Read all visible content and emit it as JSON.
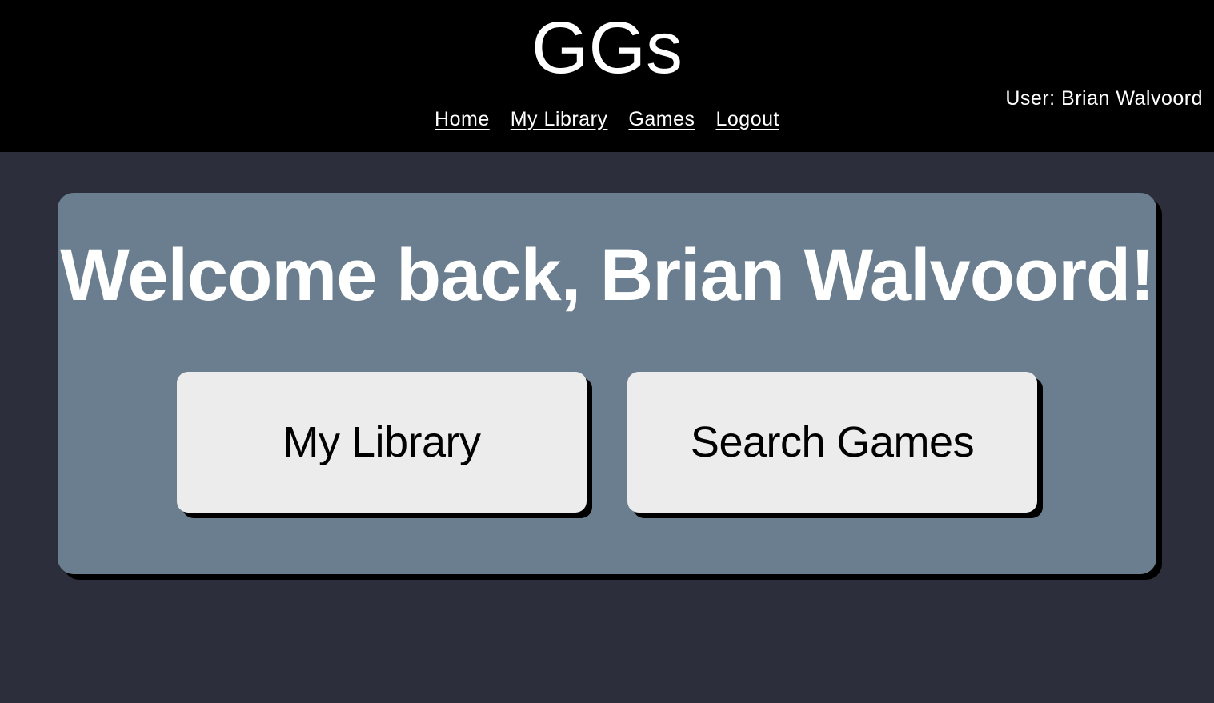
{
  "header": {
    "title": "GGs",
    "nav": [
      {
        "label": "Home"
      },
      {
        "label": "My Library"
      },
      {
        "label": "Games"
      },
      {
        "label": "Logout"
      }
    ],
    "user_label": "User: Brian Walvoord"
  },
  "main": {
    "welcome_text": "Welcome back, Brian Walvoord!",
    "buttons": {
      "library_label": "My Library",
      "search_label": "Search Games"
    }
  },
  "colors": {
    "header_bg": "#000000",
    "page_bg": "#2c2e3b",
    "card_bg": "#6a7e8f",
    "button_bg": "#ececec"
  }
}
